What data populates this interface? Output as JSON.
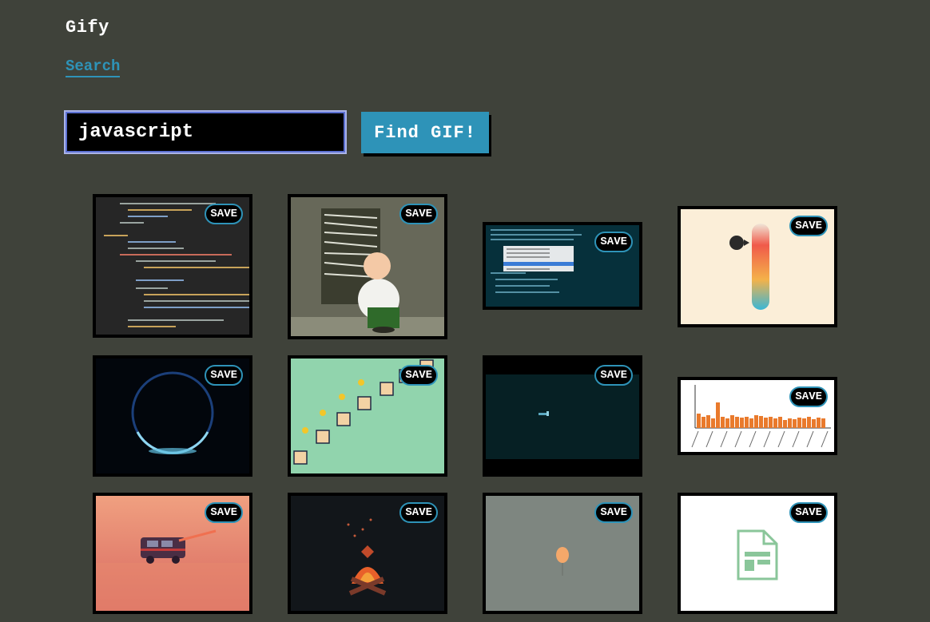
{
  "app": {
    "title": "Gify"
  },
  "nav": {
    "search_label": "Search"
  },
  "search": {
    "value": "javascript",
    "button_label": "Find GIF!"
  },
  "results": [
    {
      "save_label": "SAVE",
      "subject": "code-editor"
    },
    {
      "save_label": "SAVE",
      "subject": "cartoon-blinds"
    },
    {
      "save_label": "SAVE",
      "subject": "code-autocomplete"
    },
    {
      "save_label": "SAVE",
      "subject": "thermometer"
    },
    {
      "save_label": "SAVE",
      "subject": "glowing-ring"
    },
    {
      "save_label": "SAVE",
      "subject": "boxes-ducks"
    },
    {
      "save_label": "SAVE",
      "subject": "terminal"
    },
    {
      "save_label": "SAVE",
      "subject": "bar-chart"
    },
    {
      "save_label": "SAVE",
      "subject": "van-sunset"
    },
    {
      "save_label": "SAVE",
      "subject": "campfire"
    },
    {
      "save_label": "SAVE",
      "subject": "balloon"
    },
    {
      "save_label": "SAVE",
      "subject": "spreadsheet-icon"
    }
  ],
  "colors": {
    "background": "#3f423a",
    "accent": "#2e93b8"
  }
}
